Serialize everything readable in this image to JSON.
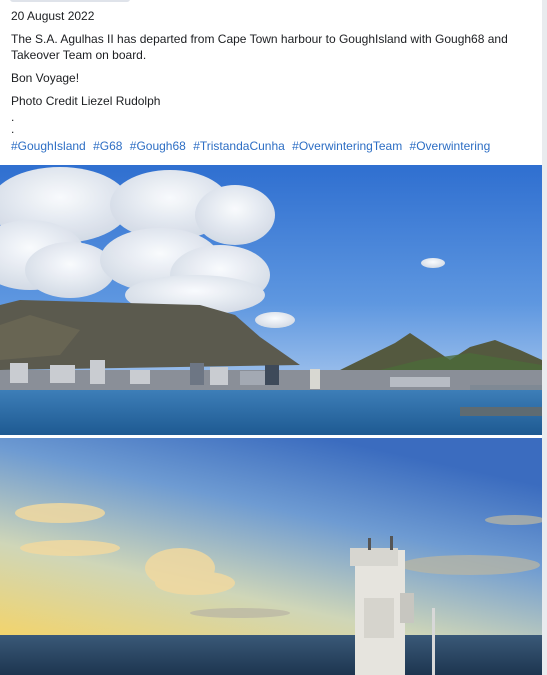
{
  "post": {
    "date": "20 August 2022",
    "paragraphs": [
      "The S.A. Agulhas II has departed from Cape Town harbour to GoughIsland with Gough68 and Takeover Team on board.",
      "Bon Voyage!",
      "Photo Credit Liezel Rudolph"
    ],
    "dots": [
      ".",
      "."
    ],
    "hashtags": [
      "#GoughIsland",
      "#G68",
      "#Gough68",
      "#TristandaCunha",
      "#OverwinteringTeam",
      "#Overwintering"
    ]
  },
  "colors": {
    "link": "#2d6ec4",
    "text": "#1c1e21"
  }
}
